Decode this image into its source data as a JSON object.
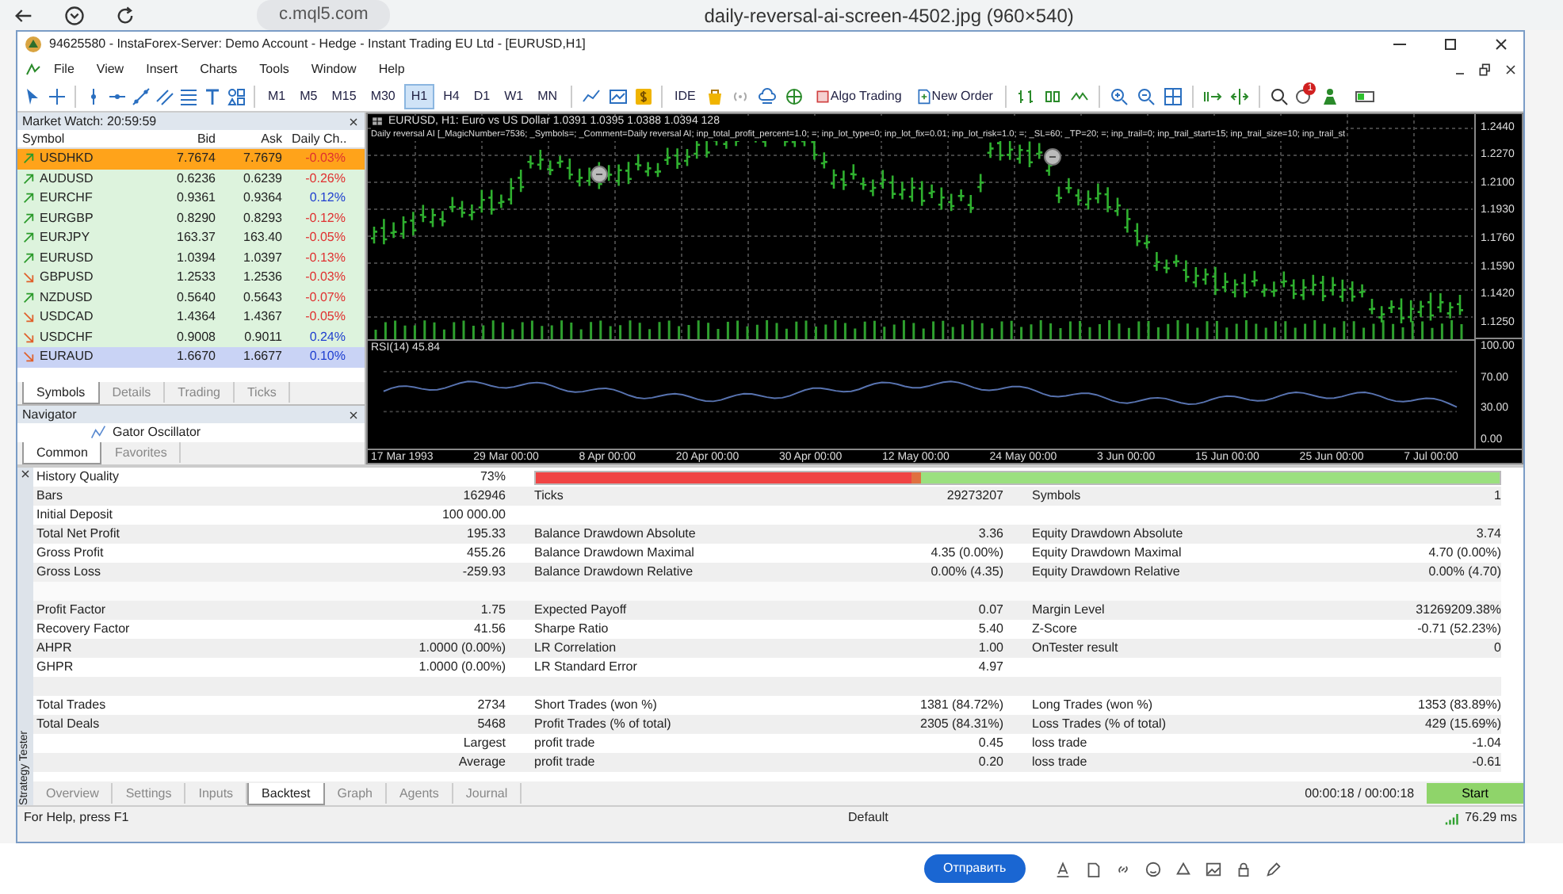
{
  "browser": {
    "url": "c.mql5.com",
    "tab_title": "daily-reversal-ai-screen-4502.jpg (960×540)"
  },
  "window": {
    "title": "94625580 - InstaForex-Server: Demo Account - Hedge - Instant Trading EU Ltd - [EURUSD,H1]"
  },
  "menu": [
    "File",
    "View",
    "Insert",
    "Charts",
    "Tools",
    "Window",
    "Help"
  ],
  "toolbar": {
    "timeframes": [
      {
        "label": "M1",
        "selected": false
      },
      {
        "label": "M5",
        "selected": false
      },
      {
        "label": "M15",
        "selected": false
      },
      {
        "label": "M30",
        "selected": false
      },
      {
        "label": "H1",
        "selected": true
      },
      {
        "label": "H4",
        "selected": false
      },
      {
        "label": "D1",
        "selected": false
      },
      {
        "label": "W1",
        "selected": false
      },
      {
        "label": "MN",
        "selected": false
      }
    ],
    "ide": "IDE",
    "algo_trading": "Algo Trading",
    "new_order": "New Order",
    "notification_count": "1"
  },
  "market_watch": {
    "title": "Market Watch: 20:59:59",
    "columns": [
      "Symbol",
      "Bid",
      "Ask",
      "Daily Ch.."
    ],
    "rows": [
      {
        "symbol": "USDHKD",
        "bid": "7.7674",
        "ask": "7.7679",
        "change": "-0.03%",
        "arrow_up": true,
        "change_up": false,
        "color": "#ffa31a"
      },
      {
        "symbol": "AUDUSD",
        "bid": "0.6236",
        "ask": "0.6239",
        "change": "-0.26%",
        "arrow_up": true,
        "change_up": false,
        "color": "#ddf3dd"
      },
      {
        "symbol": "EURCHF",
        "bid": "0.9361",
        "ask": "0.9364",
        "change": "0.12%",
        "arrow_up": true,
        "change_up": true,
        "color": "#ddf3dd"
      },
      {
        "symbol": "EURGBP",
        "bid": "0.8290",
        "ask": "0.8293",
        "change": "-0.12%",
        "arrow_up": true,
        "change_up": false,
        "color": "#ddf3dd"
      },
      {
        "symbol": "EURJPY",
        "bid": "163.37",
        "ask": "163.40",
        "change": "-0.05%",
        "arrow_up": true,
        "change_up": false,
        "color": "#ddf3dd"
      },
      {
        "symbol": "EURUSD",
        "bid": "1.0394",
        "ask": "1.0397",
        "change": "-0.13%",
        "arrow_up": true,
        "change_up": false,
        "color": "#ddf3dd"
      },
      {
        "symbol": "GBPUSD",
        "bid": "1.2533",
        "ask": "1.2536",
        "change": "-0.03%",
        "arrow_up": false,
        "change_up": false,
        "color": "#ddf3dd"
      },
      {
        "symbol": "NZDUSD",
        "bid": "0.5640",
        "ask": "0.5643",
        "change": "-0.07%",
        "arrow_up": true,
        "change_up": false,
        "color": "#ddf3dd"
      },
      {
        "symbol": "USDCAD",
        "bid": "1.4364",
        "ask": "1.4367",
        "change": "-0.05%",
        "arrow_up": false,
        "change_up": false,
        "color": "#ddf3dd"
      },
      {
        "symbol": "USDCHF",
        "bid": "0.9008",
        "ask": "0.9011",
        "change": "0.24%",
        "arrow_up": false,
        "change_up": true,
        "color": "#ddf3dd"
      },
      {
        "symbol": "EURAUD",
        "bid": "1.6670",
        "ask": "1.6677",
        "change": "0.10%",
        "arrow_up": false,
        "change_up": true,
        "color": "#c9d3f5"
      }
    ],
    "tabs": [
      {
        "label": "Symbols",
        "selected": true
      },
      {
        "label": "Details",
        "selected": false
      },
      {
        "label": "Trading",
        "selected": false
      },
      {
        "label": "Ticks",
        "selected": false
      }
    ]
  },
  "navigator": {
    "title": "Navigator",
    "items": [
      "Gator Oscillator"
    ],
    "tabs": [
      {
        "label": "Common",
        "selected": true
      },
      {
        "label": "Favorites",
        "selected": false
      }
    ]
  },
  "chart": {
    "header": "EURUSD, H1:  Euro vs US Dollar  1.0391 1.0395 1.0388 1.0394  128",
    "expert": "Daily reversal AI [_MagicNumber=7536; _Symbols=; _Comment=Daily reversal AI; inp_total_profit_percent=1.0; =; inp_lot_type=0; inp_lot_fix=0.01; inp_lot_risk=1.0; =; _SL=60; _TP=20; =; inp_trail=0; inp_trail_start=15; inp_trail_size=10; inp_trail_st",
    "price_axis": [
      "1.2440",
      "1.2270",
      "1.2100",
      "1.1930",
      "1.1760",
      "1.1590",
      "1.1420",
      "1.1250"
    ],
    "rsi_label": "RSI(14) 45.84",
    "rsi_axis": [
      "100.00",
      "70.00",
      "30.00",
      "0.00"
    ],
    "time_axis": [
      "17 Mar 1993",
      "29 Mar 00:00",
      "8 Apr 00:00",
      "20 Apr 00:00",
      "30 Apr 00:00",
      "12 May 00:00",
      "24 May 00:00",
      "3 Jun 00:00",
      "15 Jun 00:00",
      "25 Jun 00:00",
      "7 Jul 00:00"
    ]
  },
  "tester": {
    "side_label": "Strategy Tester",
    "history_quality": {
      "label": "History Quality",
      "value": "73%"
    },
    "rows": [
      {
        "kind": "data",
        "cells": [
          {
            "label": "Bars",
            "value": "162946"
          },
          {
            "label": "Ticks",
            "value": "29273207"
          },
          {
            "label": "Symbols",
            "value": "1"
          }
        ]
      },
      {
        "kind": "data",
        "cells": [
          {
            "label": "Initial Deposit",
            "value": "100 000.00"
          }
        ]
      },
      {
        "kind": "data",
        "cells": [
          {
            "label": "Total Net Profit",
            "value": "195.33"
          },
          {
            "label": "Balance Drawdown Absolute",
            "value": "3.36"
          },
          {
            "label": "Equity Drawdown Absolute",
            "value": "3.74"
          }
        ]
      },
      {
        "kind": "data",
        "cells": [
          {
            "label": "Gross Profit",
            "value": "455.26"
          },
          {
            "label": "Balance Drawdown Maximal",
            "value": "4.35 (0.00%)"
          },
          {
            "label": "Equity Drawdown Maximal",
            "value": "4.70 (0.00%)"
          }
        ]
      },
      {
        "kind": "data",
        "cells": [
          {
            "label": "Gross Loss",
            "value": "-259.93"
          },
          {
            "label": "Balance Drawdown Relative",
            "value": "0.00% (4.35)"
          },
          {
            "label": "Equity Drawdown Relative",
            "value": "0.00% (4.70)"
          }
        ]
      },
      {
        "kind": "spacer"
      },
      {
        "kind": "data",
        "cells": [
          {
            "label": "Profit Factor",
            "value": "1.75"
          },
          {
            "label": "Expected Payoff",
            "value": "0.07"
          },
          {
            "label": "Margin Level",
            "value": "31269209.38%"
          }
        ]
      },
      {
        "kind": "data",
        "cells": [
          {
            "label": "Recovery Factor",
            "value": "41.56"
          },
          {
            "label": "Sharpe Ratio",
            "value": "5.40"
          },
          {
            "label": "Z-Score",
            "value": "-0.71 (52.23%)"
          }
        ]
      },
      {
        "kind": "data",
        "cells": [
          {
            "label": "AHPR",
            "value": "1.0000 (0.00%)"
          },
          {
            "label": "LR Correlation",
            "value": "1.00"
          },
          {
            "label": "OnTester result",
            "value": "0"
          }
        ]
      },
      {
        "kind": "data",
        "cells": [
          {
            "label": "GHPR",
            "value": "1.0000 (0.00%)"
          },
          {
            "label": "LR Standard Error",
            "value": "4.97"
          }
        ]
      },
      {
        "kind": "spacer"
      },
      {
        "kind": "data",
        "cells": [
          {
            "label": "Total Trades",
            "value": "2734"
          },
          {
            "label": "Short Trades (won %)",
            "value": "1381 (84.72%)"
          },
          {
            "label": "Long Trades (won %)",
            "value": "1353 (83.89%)"
          }
        ]
      },
      {
        "kind": "data",
        "cells": [
          {
            "label": "Total Deals",
            "value": "5468"
          },
          {
            "label": "Profit Trades (% of total)",
            "value": "2305 (84.31%)"
          },
          {
            "label": "Loss Trades (% of total)",
            "value": "429 (15.69%)"
          }
        ]
      },
      {
        "kind": "data",
        "cells": [
          {
            "value": "Largest"
          },
          {
            "label": "profit trade",
            "value": "0.45"
          },
          {
            "label": "loss trade",
            "value": "-1.04"
          }
        ]
      },
      {
        "kind": "data",
        "cells": [
          {
            "value": "Average"
          },
          {
            "label": "profit trade",
            "value": "0.20"
          },
          {
            "label": "loss trade",
            "value": "-0.61"
          }
        ]
      }
    ],
    "tabs": [
      {
        "label": "Overview",
        "selected": false
      },
      {
        "label": "Settings",
        "selected": false
      },
      {
        "label": "Inputs",
        "selected": false
      },
      {
        "label": "Backtest",
        "selected": true
      },
      {
        "label": "Graph",
        "selected": false
      },
      {
        "label": "Agents",
        "selected": false
      },
      {
        "label": "Journal",
        "selected": false
      }
    ],
    "elapsed": "00:00:18 / 00:00:18",
    "start": "Start"
  },
  "status_bar": {
    "help": "For Help, press F1",
    "profile": "Default",
    "ping": "76.29 ms"
  },
  "page_behind": {
    "send_button": "Отправить"
  }
}
